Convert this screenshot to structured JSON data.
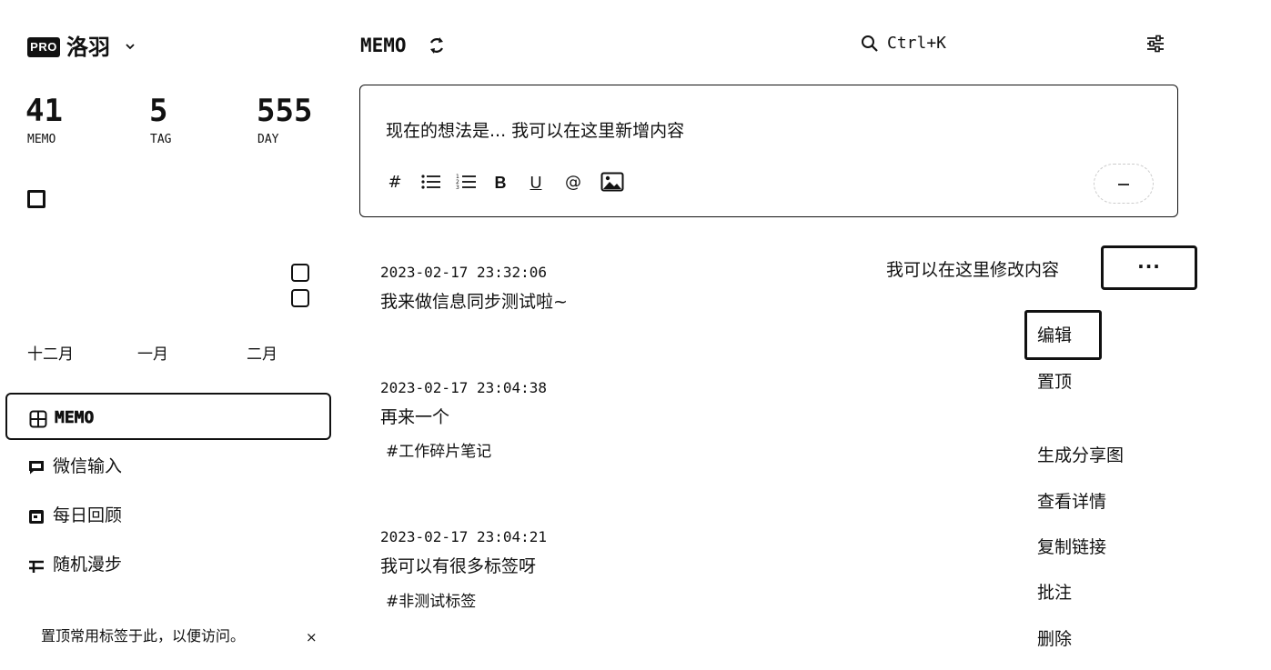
{
  "sidebar": {
    "badge": "PRO",
    "user": "洛羽",
    "stats": [
      {
        "value": "41",
        "label": "MEMO"
      },
      {
        "value": "5",
        "label": "TAG"
      },
      {
        "value": "555",
        "label": "DAY"
      }
    ],
    "months": [
      "十二月",
      "一月",
      "二月"
    ],
    "nav": [
      {
        "label": "MEMO",
        "icon": "grid-icon"
      },
      {
        "label": "微信输入",
        "icon": "chat-icon"
      },
      {
        "label": "每日回顾",
        "icon": "calendar-icon"
      },
      {
        "label": "随机漫步",
        "icon": "shuffle-icon"
      }
    ],
    "tip": "置顶常用标签于此，以便访问。",
    "tip_close": "×"
  },
  "header": {
    "title": "MEMO",
    "search_hint": "Ctrl+K"
  },
  "editor": {
    "text": "现在的想法是...   我可以在这里新增内容",
    "toolbar": [
      "#",
      "bullet-list-icon",
      "numbered-list-icon",
      "B",
      "U",
      "@",
      "image-icon"
    ]
  },
  "memos": [
    {
      "time": "2023-02-17 23:32:06",
      "text": "我来做信息同步测试啦~",
      "tag": ""
    },
    {
      "time": "2023-02-17 23:04:38",
      "text": "再来一个",
      "tag": "#工作碎片笔记"
    },
    {
      "time": "2023-02-17 23:04:21",
      "text": "我可以有很多标签呀",
      "tag": "#非测试标签"
    }
  ],
  "annotation": "我可以在这里修改内容",
  "more_label": "···",
  "menu": [
    "编辑",
    "置顶",
    "生成分享图",
    "查看详情",
    "复制链接",
    "批注",
    "删除"
  ]
}
